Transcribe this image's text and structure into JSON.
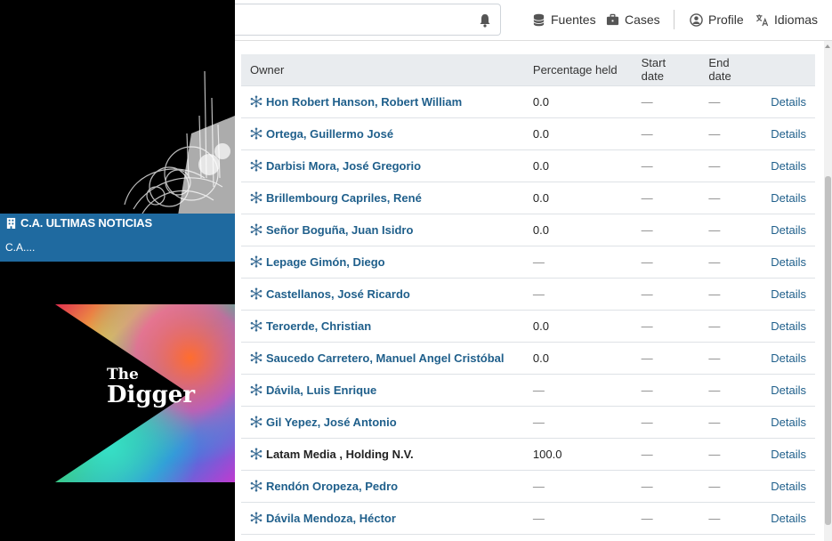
{
  "header": {
    "nav": [
      {
        "label": "Fuentes",
        "icon": "database-icon"
      },
      {
        "label": "Cases",
        "icon": "briefcase-icon"
      },
      {
        "label": "Profile",
        "icon": "user-circle-icon"
      },
      {
        "label": "Idiomas",
        "icon": "translate-icon"
      }
    ]
  },
  "entity": {
    "name": "C.A. ULTIMAS NOTICIAS",
    "subtitle": "C.A...."
  },
  "brand": {
    "logo_text_line1": "The",
    "logo_text_line2": "Digger"
  },
  "table": {
    "columns": [
      "Owner",
      "Percentage held",
      "Start date",
      "End date",
      ""
    ],
    "rows": [
      {
        "owner": "Hon Robert Hanson, Robert William",
        "percentage": "0.0",
        "start": "—",
        "end": "—",
        "action": "Details",
        "linked": true
      },
      {
        "owner": "Ortega, Guillermo José",
        "percentage": "0.0",
        "start": "—",
        "end": "—",
        "action": "Details",
        "linked": true
      },
      {
        "owner": "Darbisi Mora, José Gregorio",
        "percentage": "0.0",
        "start": "—",
        "end": "—",
        "action": "Details",
        "linked": true
      },
      {
        "owner": "Brillembourg Capriles, René",
        "percentage": "0.0",
        "start": "—",
        "end": "—",
        "action": "Details",
        "linked": true
      },
      {
        "owner": "Señor Boguña, Juan Isidro",
        "percentage": "0.0",
        "start": "—",
        "end": "—",
        "action": "Details",
        "linked": true
      },
      {
        "owner": "Lepage Gimón, Diego",
        "percentage": "—",
        "start": "—",
        "end": "—",
        "action": "Details",
        "linked": true
      },
      {
        "owner": "Castellanos, José Ricardo",
        "percentage": "—",
        "start": "—",
        "end": "—",
        "action": "Details",
        "linked": true
      },
      {
        "owner": "Teroerde, Christian",
        "percentage": "0.0",
        "start": "—",
        "end": "—",
        "action": "Details",
        "linked": true
      },
      {
        "owner": "Saucedo Carretero, Manuel Angel Cristóbal",
        "percentage": "0.0",
        "start": "—",
        "end": "—",
        "action": "Details",
        "linked": true
      },
      {
        "owner": "Dávila, Luis Enrique",
        "percentage": "—",
        "start": "—",
        "end": "—",
        "action": "Details",
        "linked": true
      },
      {
        "owner": "Gil Yepez, José Antonio",
        "percentage": "—",
        "start": "—",
        "end": "—",
        "action": "Details",
        "linked": true
      },
      {
        "owner": "Latam Media , Holding N.V.",
        "percentage": "100.0",
        "start": "—",
        "end": "—",
        "action": "Details",
        "linked": false
      },
      {
        "owner": "Rendón Oropeza, Pedro",
        "percentage": "—",
        "start": "—",
        "end": "—",
        "action": "Details",
        "linked": true
      },
      {
        "owner": "Dávila Mendoza, Héctor",
        "percentage": "—",
        "start": "—",
        "end": "—",
        "action": "Details",
        "linked": true
      }
    ]
  },
  "colors": {
    "accent": "#1f5f8b",
    "banner": "#1f6aa0",
    "header_bg": "#e9ecef"
  }
}
